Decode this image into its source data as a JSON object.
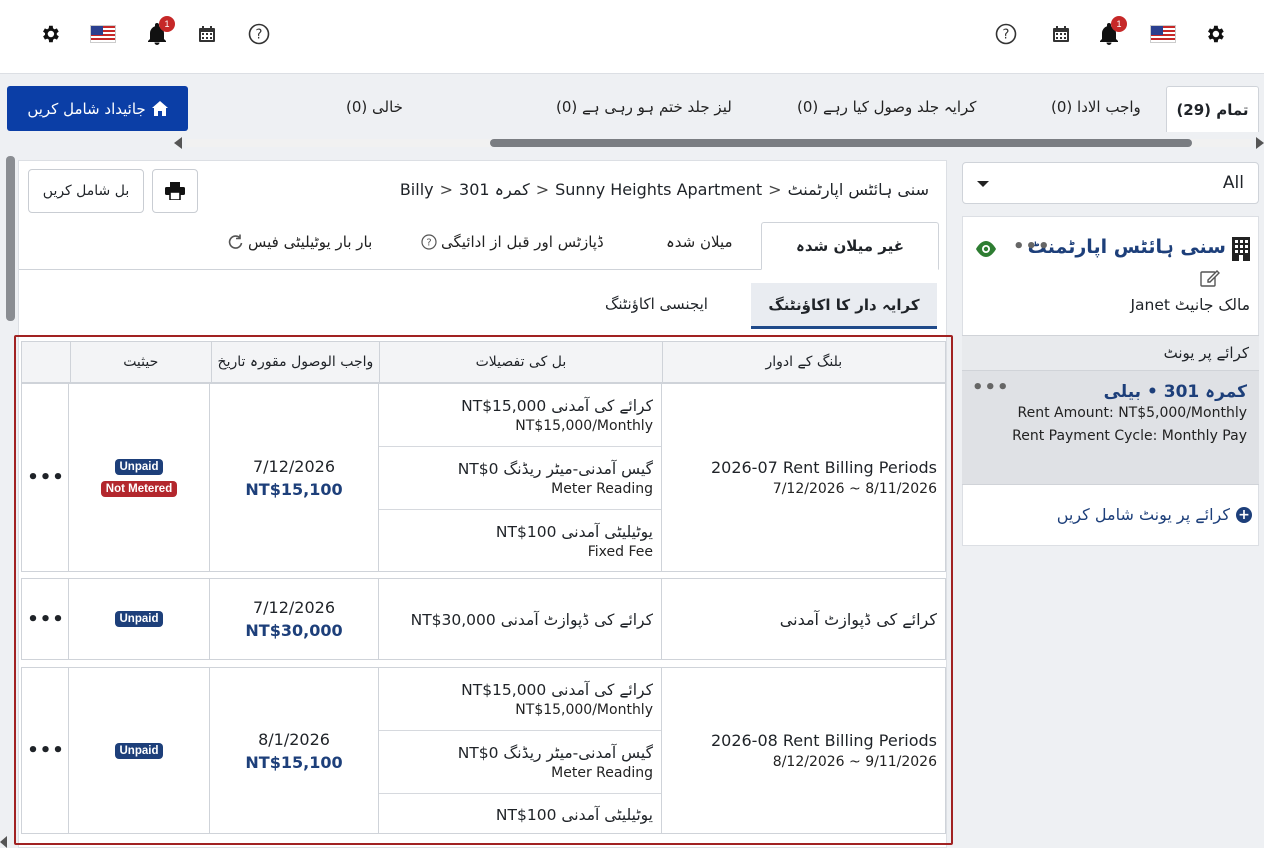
{
  "topbar": {
    "notification_count": "1"
  },
  "status_tabs": {
    "all": "تمام (29)",
    "due": "واجب الادا (0)",
    "rent_collect_soon": "کرایہ جلد وصول کیا رہے (0)",
    "lease_expiring": "لیز جلد ختم ہو رہی ہے (0)",
    "vacant": "خالی (0)",
    "add_property": "جائیداد شامل کریں"
  },
  "breadcrumb": {
    "property": "سنی ہائٹس اپارٹمنٹ",
    "building": "Sunny Heights Apartment",
    "room": "کمرہ 301",
    "tenant": "Billy"
  },
  "toolbar": {
    "add_bill": "بل شامل کریں"
  },
  "subtabs": {
    "unreconciled": "غیر میلان شدہ",
    "reconciled": "میلان شدہ",
    "deposits": "ڈپازٹس اور قبل از ادائیگی",
    "recurring": "بار بار یوٹیلیٹی فیس"
  },
  "account_tabs": {
    "tenant": "کرایہ دار کا اکاؤنٹنگ",
    "agency": "ایجنسی اکاؤنٹنگ"
  },
  "table": {
    "headers": {
      "period": "بلنگ کے ادوار",
      "details": "بل کی تفصیلات",
      "due_date": "واجب الوصول مقورہ تاریخ",
      "status": "حیثیت"
    },
    "rows": [
      {
        "period_title": "2026-07 Rent Billing Periods",
        "period_range": "7/12/2026 ~ 8/11/2026",
        "bills": [
          {
            "name": "کرائے کی آمدنی NT$15,000",
            "sub": "NT$15,000/Monthly"
          },
          {
            "name": "گیس آمدنی-میٹر ریڈنگ NT$0",
            "sub": "Meter Reading"
          },
          {
            "name": "یوٹیلیٹی آمدنی NT$100",
            "sub": "Fixed Fee"
          }
        ],
        "due_date": "7/12/2026",
        "amount": "NT$15,100",
        "status": [
          "Unpaid",
          "Not Metered"
        ],
        "actions": "•••"
      },
      {
        "period_title": "کرائے کی ڈپوازٹ آمدنی",
        "bills": [
          {
            "name": "کرائے کی ڈپوازٹ آمدنی NT$30,000"
          }
        ],
        "due_date": "7/12/2026",
        "amount": "NT$30,000",
        "status": [
          "Unpaid"
        ],
        "actions": "•••"
      },
      {
        "period_title": "2026-08 Rent Billing Periods",
        "period_range": "8/12/2026 ~ 9/11/2026",
        "bills": [
          {
            "name": "کرائے کی آمدنی NT$15,000",
            "sub": "NT$15,000/Monthly"
          },
          {
            "name": "گیس آمدنی-میٹر ریڈنگ NT$0",
            "sub": "Meter Reading"
          },
          {
            "name": "یوٹیلیٹی آمدنی NT$100"
          }
        ],
        "due_date": "8/1/2026",
        "amount": "NT$15,100",
        "status": [
          "Unpaid"
        ],
        "actions": "•••"
      }
    ]
  },
  "sidebar": {
    "filter_value": "All",
    "property_name": "سنی ہائٹس اپارٹمنٹ",
    "owner": "مالک جانیٹ Janet",
    "units_header": "کرائے پر یونٹ",
    "unit_title": "کمرہ 301 • بیلی",
    "unit_rent": "Rent Amount: NT$5,000/Monthly",
    "unit_cycle": "Rent Payment Cycle: Monthly Pay",
    "add_unit": "کرائے پر یونٹ شامل کریں",
    "more": "•••"
  },
  "colors": {
    "primary": "#0b3ea6",
    "navy": "#1d3f7a",
    "danger": "#b3272d",
    "highlight_border": "#a12222",
    "eye": "#2e7d32"
  }
}
